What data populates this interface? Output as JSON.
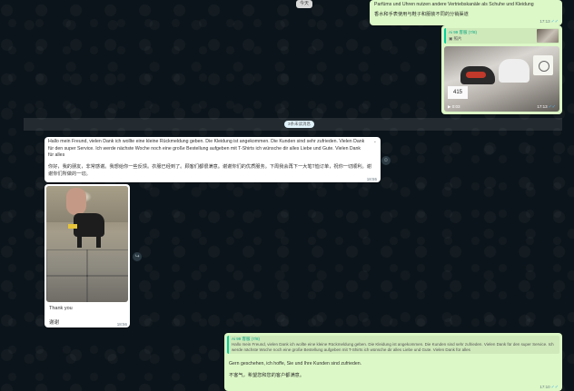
{
  "date_chip": "今天",
  "msg1": {
    "line1": "Parfüms und Uhren nutzen andere Vertriebskanäle als Schuhe und Kleidung",
    "line2": "香水和手表使用与鞋子和服装不同的分销渠道",
    "time": "17:13"
  },
  "msg2": {
    "quote_sender": "Ai 99 客服 (7/8)",
    "quote_text": "照片",
    "video_duration": "0:03",
    "time": "17:13",
    "photo_tag": "415"
  },
  "unread_banner": "3条未读消息",
  "msg3": {
    "german": "Hallo mein Freund, vielen Dank ich wollte eine kleine Rückmeldung geben. Die Kleidung ist angekommen. Die Kunden sind sehr zufrieden. Vielen Dank für den super Service. Ich werde nächste Woche noch eine große Bestellung aufgeben mit T-Shirts ich wünsche dir alles Liebe und Gute. Vielen Dank für alles",
    "chinese": "你好，我的朋友，非常感谢。我想给你一些反馈。衣服已经到了。顾客们都很满意。谢谢你们的优质服务。下周我会再下一大笔T恤订单，祝你一切顺利。谢谢你们所做的一切。",
    "time": "18:55"
  },
  "msg4": {
    "caption1": "Thank you",
    "caption2": "谢谢",
    "time": "18:56"
  },
  "msg5": {
    "quote_sender": "Ai 99 客服 (7/8)",
    "quote_text": "Hallo mein Freund, vielen Dank ich wollte eine kleine Rückmeldung geben. Die Kleidung ist angekommen. Die Kunden sind sehr zufrieden. Vielen Dank für den super Service. Ich werde nächste Woche noch eine große Bestellung aufgeben mit T-Shirts ich wünsche dir alles Liebe und Gute. Vielen Dank für alles",
    "text1": "Gern geschehen, ich hoffe, Sie und Ihre Kunden sind zufrieden.",
    "text2": "不客气，希望您和您的客户都满意。",
    "time": "17:10"
  },
  "icons": {
    "forward": "forward-icon",
    "emoji": "emoji-reaction-icon",
    "chevron": "chevron-down-icon",
    "video": "video-camera-icon",
    "photo": "photo-icon",
    "read": "read-receipt-icon"
  },
  "colors": {
    "background": "#0b141a",
    "outgoing": "#dcf8c6",
    "incoming": "#ffffff",
    "accent": "#06cf9c",
    "read_tick": "#4fb6ec"
  }
}
